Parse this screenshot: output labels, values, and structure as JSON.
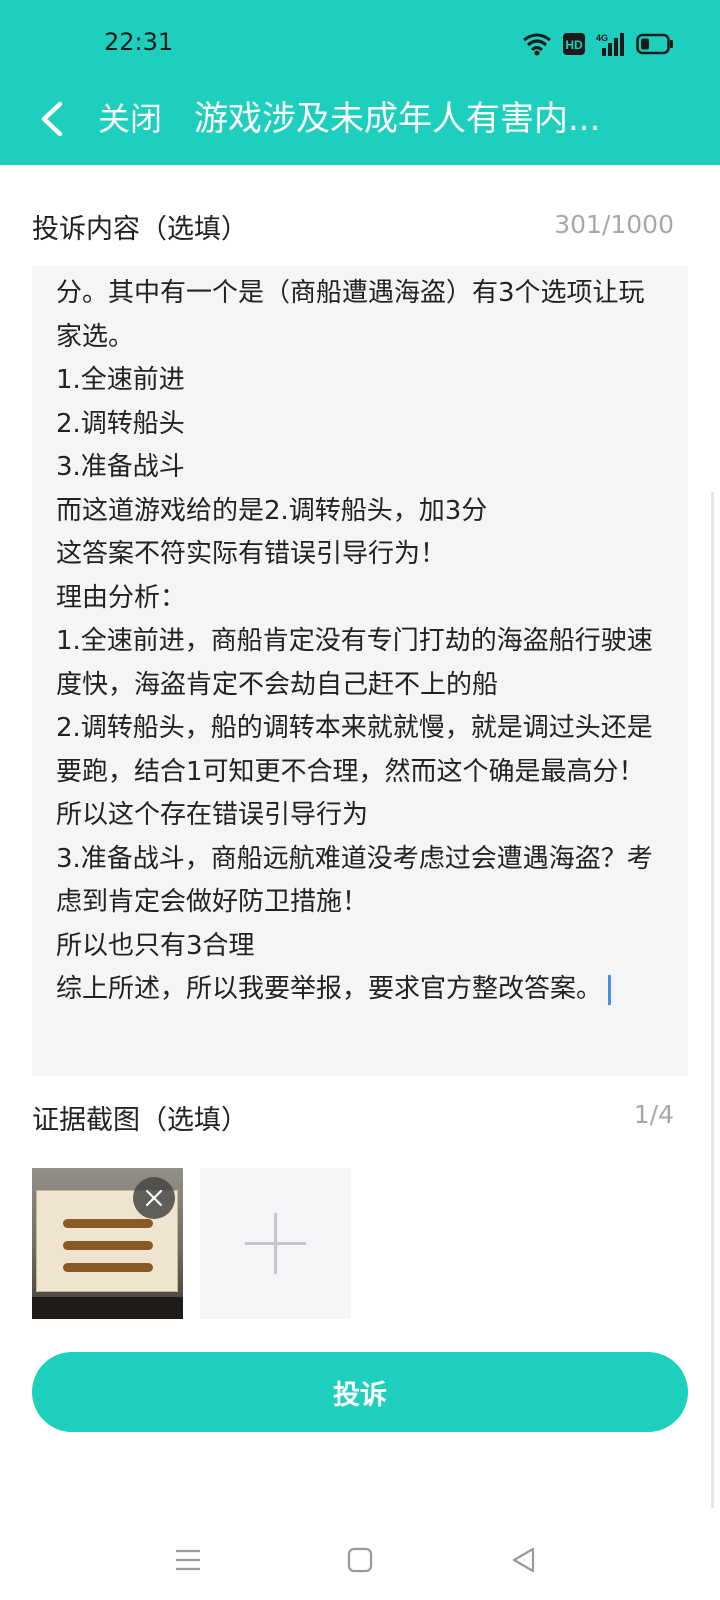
{
  "status_bar": {
    "time": "22:31",
    "hd_label": "HD",
    "network_label": "4G"
  },
  "title_bar": {
    "close_label": "关闭",
    "title": "游戏涉及未成年人有害内..."
  },
  "complaint": {
    "label": "投诉内容（选填）",
    "counter": "301/1000",
    "text": "分。其中有一个是（商船遭遇海盗）有3个选项让玩家选。\n1.全速前进\n2.调转船头\n3.准备战斗\n而这道游戏给的是2.调转船头，加3分\n这答案不符实际有错误引导行为！\n理由分析：\n1.全速前进，商船肯定没有专门打劫的海盗船行驶速度快，海盗肯定不会劫自己赶不上的船\n2.调转船头，船的调转本来就就慢，就是调过头还是要跑，结合1可知更不合理，然而这个确是最高分！所以这个存在错误引导行为\n3.准备战斗，商船远航难道没考虑过会遭遇海盗？考虑到肯定会做好防卫措施！\n所以也只有3合理\n综上所述，所以我要举报，要求官方整改答案。"
  },
  "evidence": {
    "label": "证据截图（选填）",
    "counter": "1/4"
  },
  "submit_label": "投诉",
  "colors": {
    "accent": "#1ecfbd",
    "field_bg": "#f4f5f7",
    "caret": "#4a90e2"
  },
  "icons": [
    "back-arrow-icon",
    "wifi-icon",
    "hd-icon",
    "signal-icon",
    "battery-icon",
    "close-icon",
    "plus-icon",
    "menu-icon",
    "home-icon",
    "back-triangle-icon"
  ]
}
